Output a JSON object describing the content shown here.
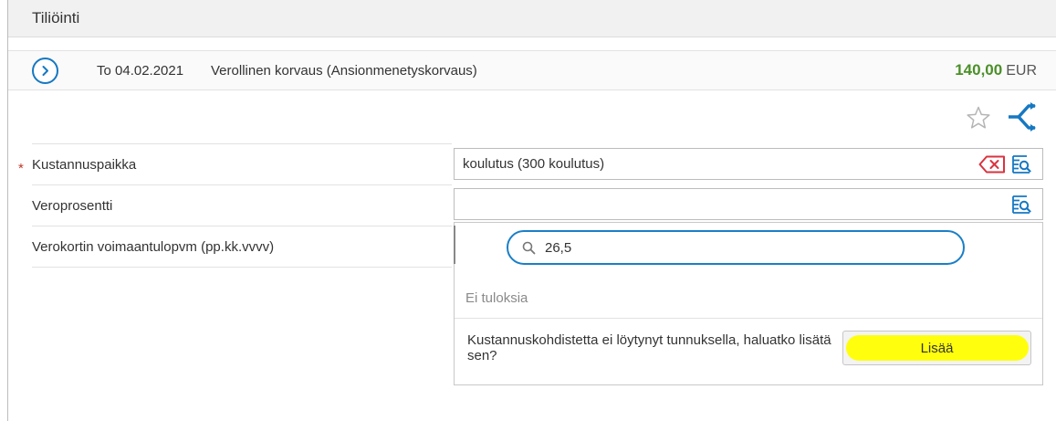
{
  "header": {
    "title": "Tiliöinti"
  },
  "transaction": {
    "date": "To 04.02.2021",
    "description": "Verollinen korvaus (Ansionmenetyskorvaus)",
    "amount": "140,00",
    "currency": "EUR",
    "expand_icon": "chevron-right-circle-icon"
  },
  "toolbar": {
    "favorite_icon": "star-outline-icon",
    "split_icon": "shuffle-arrows-icon"
  },
  "form": {
    "required_mark": "*",
    "fields": [
      {
        "label": "Kustannuspaikka",
        "value": "koulutus (300 koulutus)",
        "required": true
      },
      {
        "label": "Veroprosentti",
        "value": ""
      },
      {
        "label": "Verokortin voimaantulopvm (pp.kk.vvvv)"
      }
    ]
  },
  "dropdown": {
    "search_value": "26,5",
    "no_results": "Ei tuloksia",
    "not_found_message": "Kustannuskohdistetta ei löytynyt tunnuksella, haluatko lisätä sen?",
    "add_label": "Lisää"
  },
  "colors": {
    "accent": "#1678c2",
    "amount": "#4b8f28",
    "clear": "#d9333f",
    "highlight": "#ffff00"
  }
}
